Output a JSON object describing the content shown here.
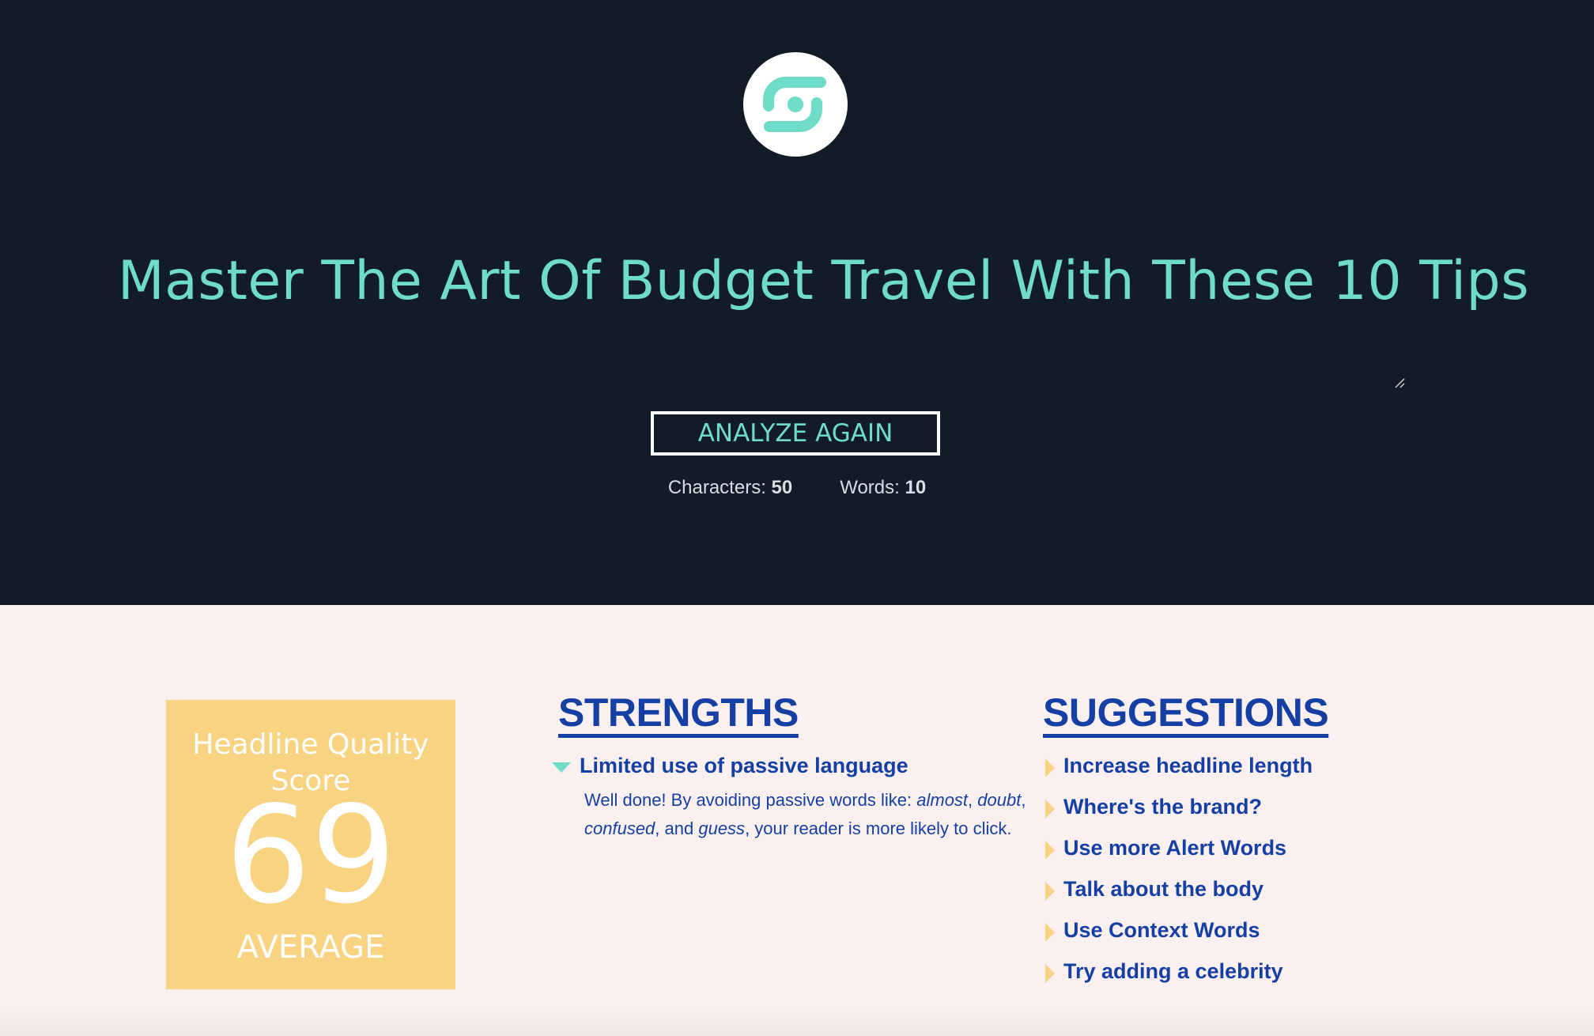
{
  "colors": {
    "hero_bg": "#121c28",
    "accent": "#6fdcc8",
    "score_bg": "#f7d382",
    "text_blue": "#163fa4",
    "page_bg": "#f9f0ef"
  },
  "logo": {
    "icon": "brand-logo-icon"
  },
  "headline": "Master The Art Of Budget Travel With These 10 Tips",
  "analyze_button": "ANALYZE AGAIN",
  "stats": {
    "characters_label": "Characters:",
    "characters": "50",
    "words_label": "Words:",
    "words": "10"
  },
  "score": {
    "label": "Headline Quality Score",
    "value": "69",
    "grade": "AVERAGE"
  },
  "strengths": {
    "title": "STRENGTHS",
    "items": [
      {
        "label": "Limited use of passive language",
        "expanded": true,
        "body": {
          "t1": "Well done! By avoiding passive words like: ",
          "w1": "almost",
          "t2": ", ",
          "w2": "doubt",
          "t3": ", ",
          "w3": "confused",
          "t4": ", and ",
          "w4": "guess",
          "t5": ", your reader is more likely to click."
        }
      }
    ]
  },
  "suggestions": {
    "title": "SUGGESTIONS",
    "items": [
      "Increase headline length",
      "Where's the brand?",
      "Use more Alert Words",
      "Talk about the body",
      "Use Context Words",
      "Try adding a celebrity"
    ]
  }
}
